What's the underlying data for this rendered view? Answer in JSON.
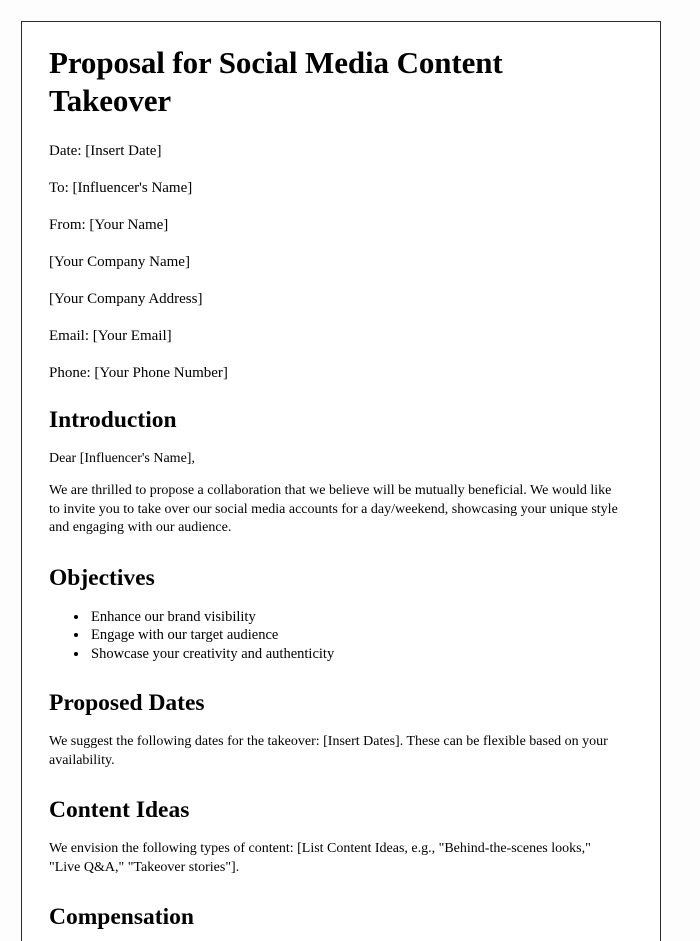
{
  "document": {
    "title": "Proposal for Social Media Content Takeover",
    "meta_lines": [
      {
        "text": "Date: [Insert Date]"
      },
      {
        "text": "To: [Influencer's Name]"
      },
      {
        "text": "From: [Your Name]"
      },
      {
        "text": "[Your Company Name]"
      },
      {
        "text": "[Your Company Address]"
      },
      {
        "text": "Email: [Your Email]"
      },
      {
        "text": "Phone: [Your Phone Number]"
      }
    ],
    "sections": {
      "introduction": {
        "heading": "Introduction",
        "salutation": "Dear [Influencer's Name],",
        "paragraph": "We are thrilled to propose a collaboration that we believe will be mutually beneficial. We would like to invite you to take over our social media accounts for a day/weekend, showcasing your unique style and engaging with our audience."
      },
      "objectives": {
        "heading": "Objectives",
        "items": [
          "Enhance our brand visibility",
          "Engage with our target audience",
          "Showcase your creativity and authenticity"
        ]
      },
      "proposed_dates": {
        "heading": "Proposed Dates",
        "paragraph": "We suggest the following dates for the takeover: [Insert Dates]. These can be flexible based on your availability."
      },
      "content_ideas": {
        "heading": "Content Ideas",
        "paragraph": "We envision the following types of content: [List Content Ideas, e.g., \"Behind-the-scenes looks,\" \"Live Q&A,\" \"Takeover stories\"]."
      },
      "compensation": {
        "heading": "Compensation"
      }
    }
  }
}
